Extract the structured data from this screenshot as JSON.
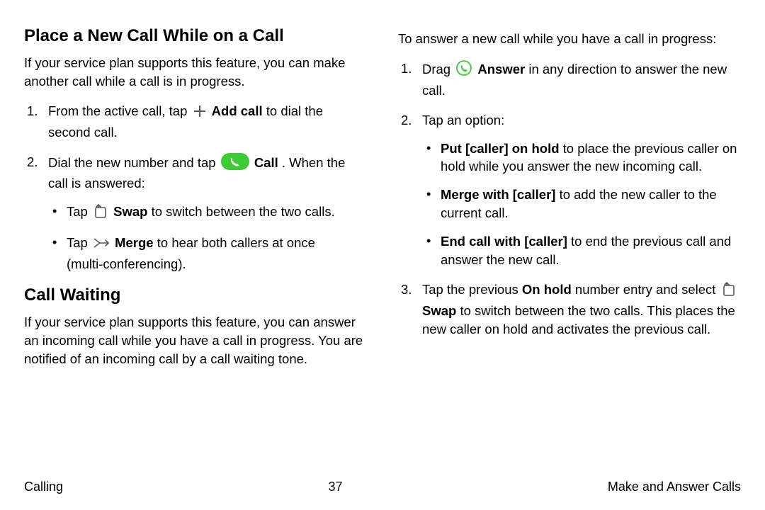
{
  "left": {
    "h1": "Place a New Call While on a Call",
    "p1": "If your service plan supports this feature, you can make another call while a call is in progress.",
    "li1_a": "From the active call, tap ",
    "li1_bold": "Add call",
    "li1_b": " to dial the second call.",
    "li2_a": "Dial the new number and tap ",
    "li2_bold": "Call",
    "li2_b": ". When the call is answered:",
    "s1_a": "Tap ",
    "s1_bold": "Swap",
    "s1_b": " to switch between the two calls.",
    "s2_a": "Tap ",
    "s2_bold": "Merge",
    "s2_b": " to hear both callers at once (multi‑conferencing).",
    "h2": "Call Waiting",
    "p2": "If your service plan supports this feature, you can answer an incoming call while you have a call in progress. You are notified of an incoming call by a call waiting tone."
  },
  "right": {
    "p1": "To answer a new call while you have a call in progress:",
    "li1_a": "Drag ",
    "li1_bold": "Answer",
    "li1_b": " in any direction to answer the new call.",
    "li2": "Tap an option:",
    "o1_bold": "Put [caller] on hold",
    "o1_b": " to place the previous caller on hold while you answer the new incoming call.",
    "o2_bold": "Merge with [caller]",
    "o2_b": " to add the new caller to the current call.",
    "o3_bold": "End call with [caller]",
    "o3_b": " to end the previous call and answer the new call.",
    "li3_a": "Tap the previous ",
    "li3_bold1": "On hold",
    "li3_b": " number entry and select ",
    "li3_bold2": "Swap",
    "li3_c": " to switch between the two calls. This places the new caller on hold and activates the previous call."
  },
  "footer": {
    "left": "Calling",
    "center": "37",
    "right": "Make and Answer Calls"
  }
}
